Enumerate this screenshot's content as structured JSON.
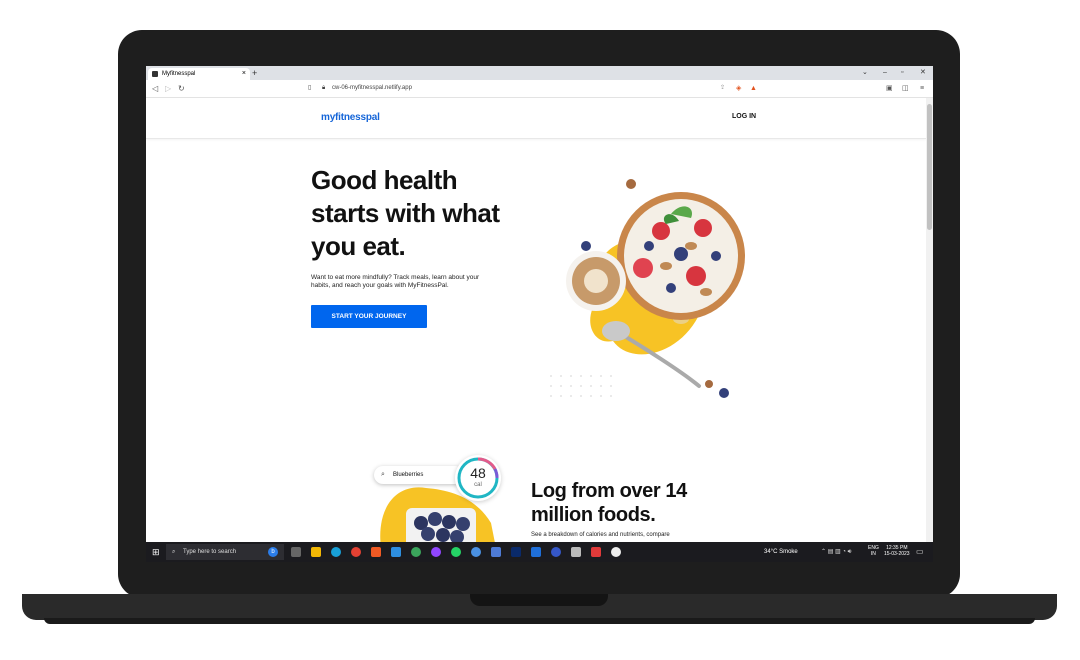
{
  "browser": {
    "tab_title": "Myfitnesspal",
    "tab_close": "×",
    "new_tab": "+",
    "url": "cw-06-myfitnesspal.netlify.app",
    "window_controls": {
      "min": "–",
      "restore": "▫",
      "close": "✕",
      "chevron": "⌄"
    }
  },
  "site": {
    "logo": "myfitnesspal",
    "login": "LOG IN",
    "hero": {
      "title": "Good health starts with what you eat.",
      "subtitle": "Want to eat more mindfully? Track meals, learn about your habits, and reach your goals with MyFitnessPal.",
      "cta": "START YOUR JOURNEY"
    },
    "section2": {
      "search_text": "Blueberries",
      "calories": "48",
      "calories_unit": "cal",
      "title": "Log from over 14 million foods.",
      "subtitle": "See a breakdown of calories and nutrients, compare"
    }
  },
  "taskbar": {
    "search_placeholder": "Type here to search",
    "weather": "34°C  Smoke",
    "lang_1": "ENG",
    "lang_2": "IN",
    "time": "12:35 PM",
    "date": "15-03-2023"
  },
  "colors": {
    "brand_blue": "#0066ee",
    "accent_yellow": "#f7c325"
  }
}
